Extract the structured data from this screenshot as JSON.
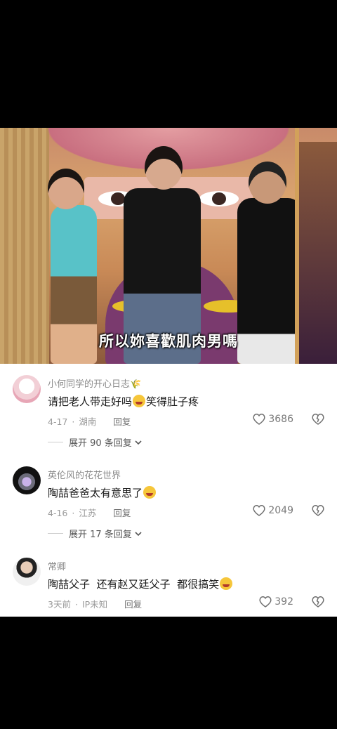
{
  "video": {
    "subtitle": "所以妳喜歡肌肉男嗎"
  },
  "comments": [
    {
      "username": "小何同学的开心日志🌾",
      "text_before": "请把老人带走好吗",
      "emoji": "laugh-cry-emoji",
      "text_after": "笑得肚子疼",
      "date": "4-17",
      "location": "湖南",
      "reply_label": "回复",
      "likes": "3686",
      "expand_label": "展开 90 条回复"
    },
    {
      "username": "英伦风的花花世界",
      "text_before": "陶喆爸爸太有意思了",
      "emoji": "laugh-cry-emoji",
      "text_after": "",
      "date": "4-16",
      "location": "江苏",
      "reply_label": "回复",
      "likes": "2049",
      "expand_label": "展开 17 条回复"
    },
    {
      "username": "常卿",
      "text_before": "陶喆父子  还有赵又廷父子  都很搞笑",
      "emoji": "rofl-emoji",
      "text_after": "",
      "date": "3天前",
      "location": "IP未知",
      "reply_label": "回复",
      "likes": "392"
    }
  ],
  "icons": {
    "like": "heart-outline-icon",
    "dislike": "broken-heart-icon",
    "expand": "chevron-down-icon"
  }
}
